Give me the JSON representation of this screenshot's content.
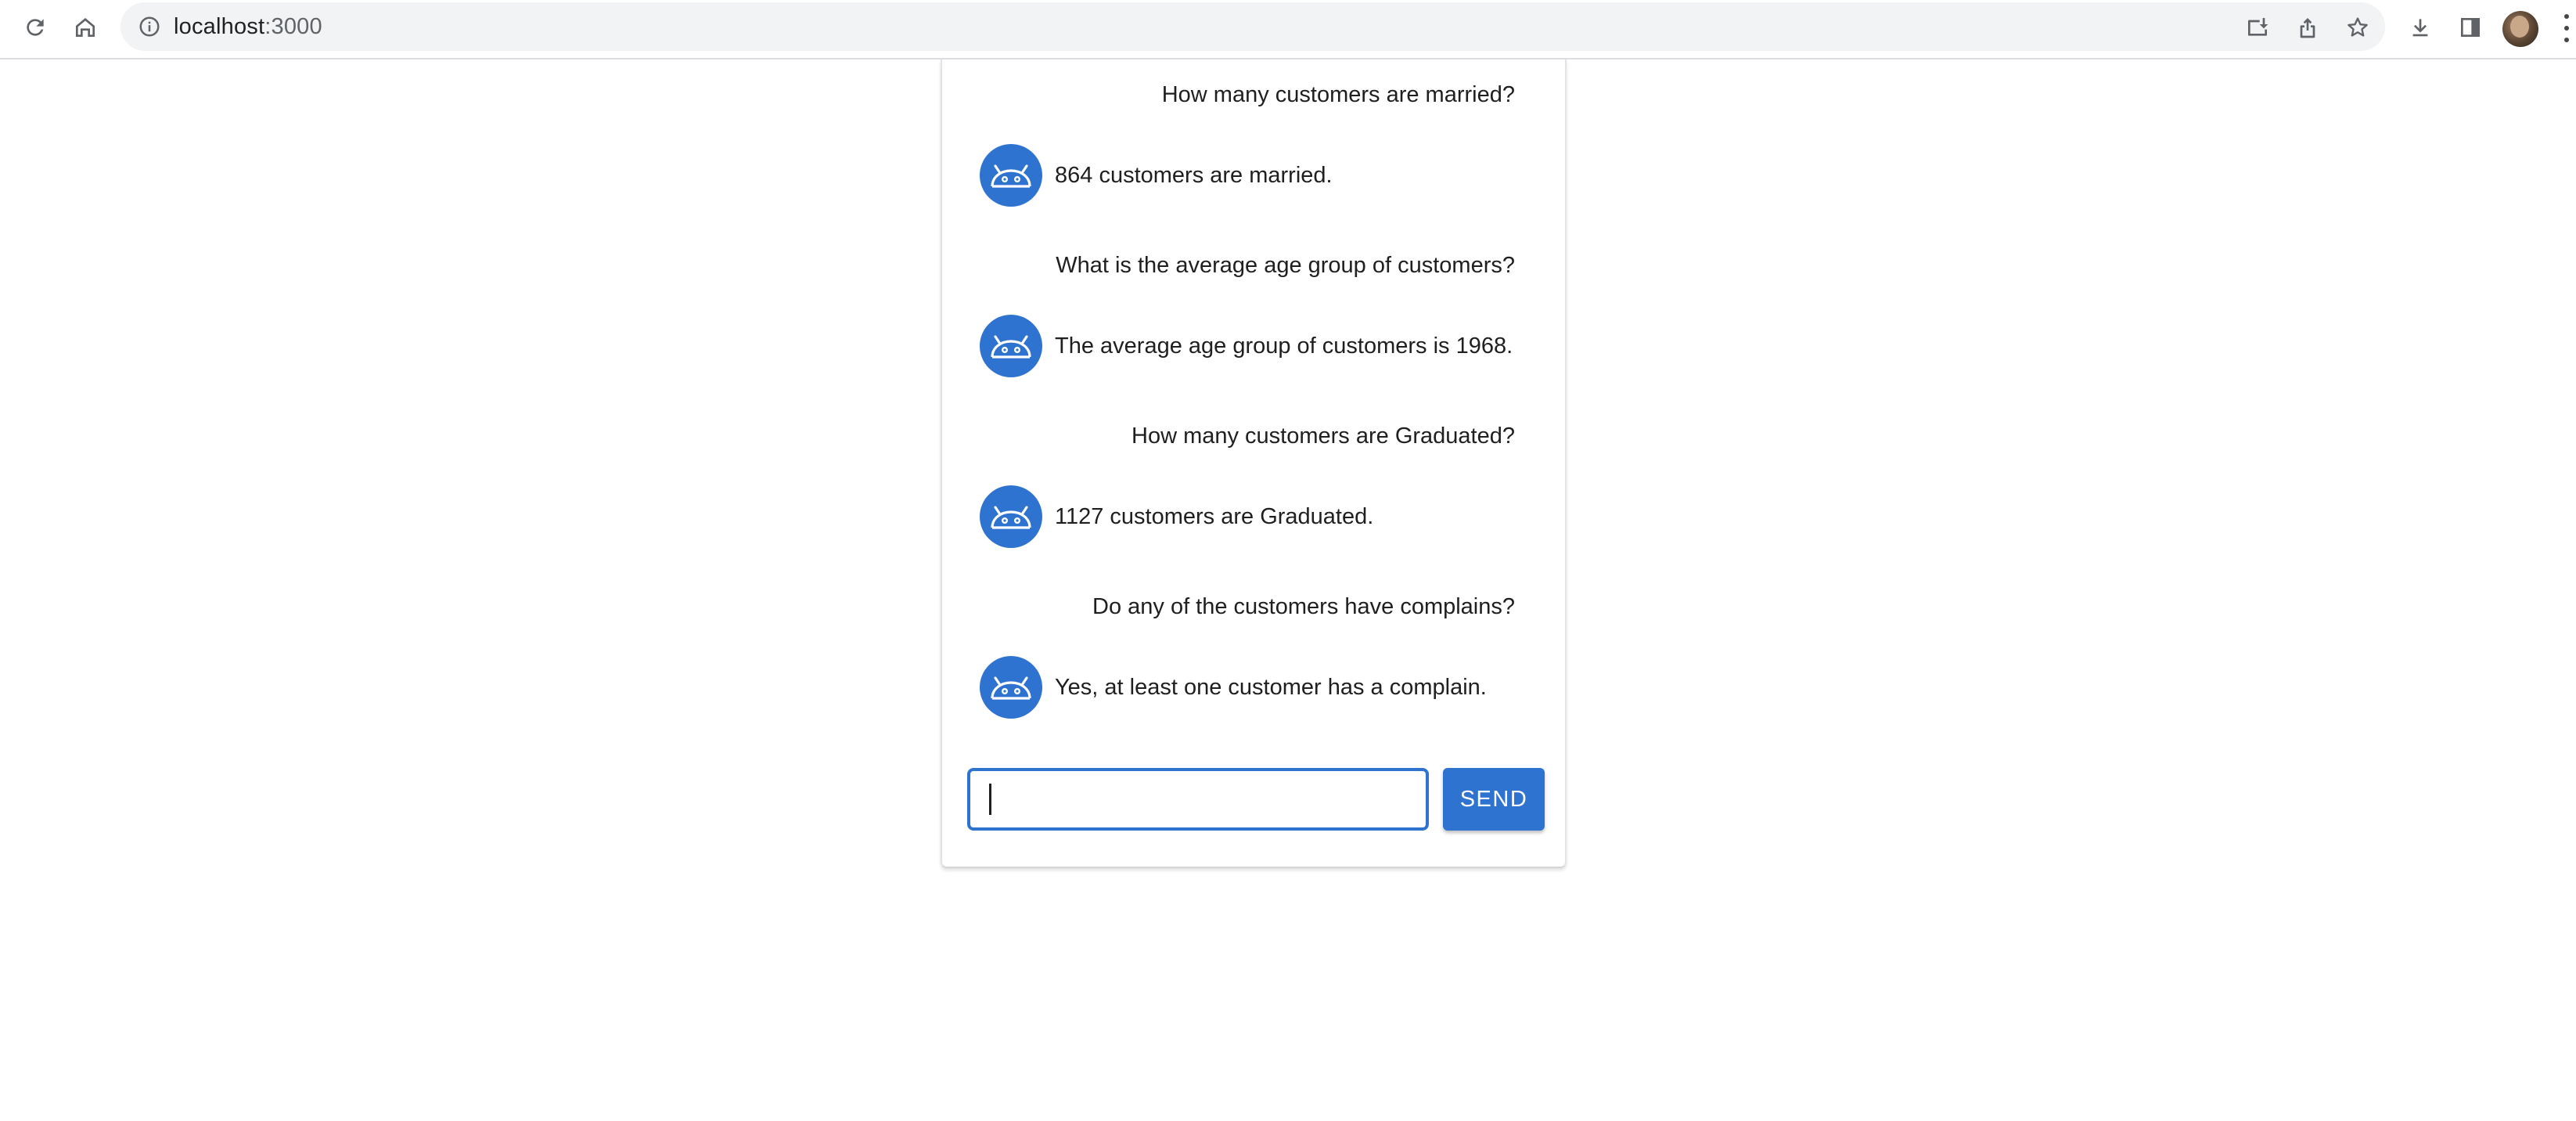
{
  "browser": {
    "url_host": "localhost",
    "url_port": ":3000",
    "icons": [
      "reload-icon",
      "home-icon",
      "site-info-icon",
      "install-app-icon",
      "share-icon",
      "bookmark-star-icon",
      "download-icon",
      "side-panel-icon",
      "profile-avatar",
      "menu-kebab-icon"
    ]
  },
  "chat": {
    "messages": [
      {
        "role": "user",
        "text": "How many customers are married?"
      },
      {
        "role": "bot",
        "text": "864 customers are married."
      },
      {
        "role": "user",
        "text": "What is the average age group of customers?"
      },
      {
        "role": "bot",
        "text": "The average age group of customers is 1968."
      },
      {
        "role": "user",
        "text": "How many customers are Graduated?"
      },
      {
        "role": "bot",
        "text": "1127 customers are Graduated."
      },
      {
        "role": "user",
        "text": "Do any of the customers have complains?"
      },
      {
        "role": "bot",
        "text": "Yes, at least one customer has a complain."
      }
    ],
    "input": {
      "value": "",
      "placeholder": ""
    },
    "send_label": "SEND",
    "accent_color": "#2f73d1"
  }
}
